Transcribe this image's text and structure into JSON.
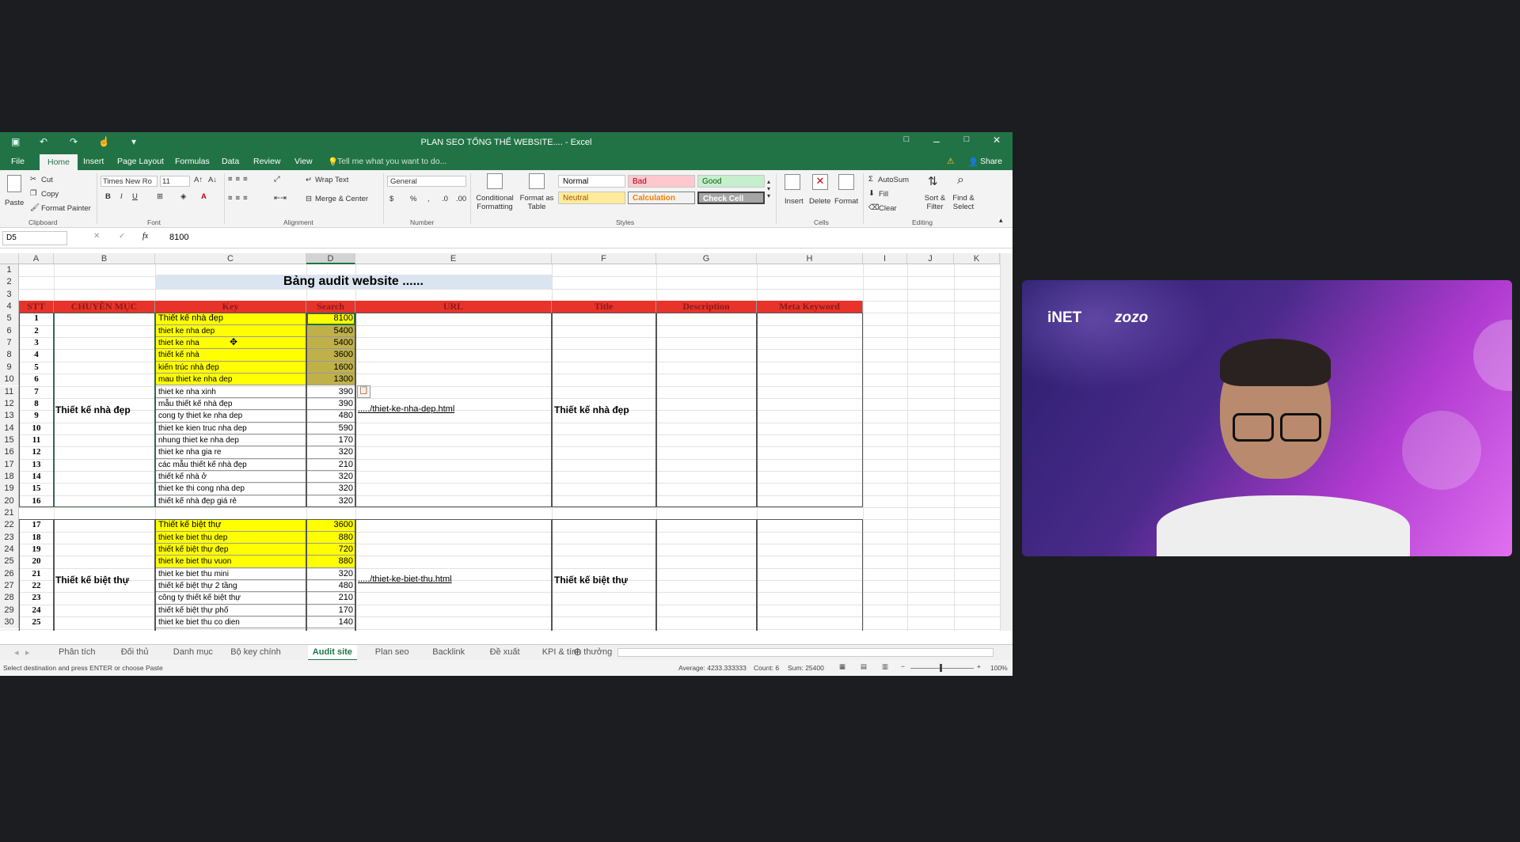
{
  "titlebar": {
    "title": "PLAN SEO TỔNG THỂ WEBSITE.... - Excel",
    "restore_icon": "□",
    "min": "–",
    "max": "□",
    "close": "✕"
  },
  "ribbon_tabs": {
    "file": "File",
    "home": "Home",
    "insert": "Insert",
    "page_layout": "Page Layout",
    "formulas": "Formulas",
    "data": "Data",
    "review": "Review",
    "view": "View",
    "tell": "Tell me what you want to do...",
    "share": "Share"
  },
  "ribbon": {
    "paste": "Paste",
    "cut": "Cut",
    "copy": "Copy",
    "format_painter": "Format Painter",
    "clipboard": "Clipboard",
    "font_name": "Times New Ro",
    "font_size": "11",
    "font": "Font",
    "wrap": "Wrap Text",
    "merge": "Merge & Center",
    "alignment": "Alignment",
    "number_format": "General",
    "number": "Number",
    "cond": "Conditional Formatting",
    "format_table": "Format as Table",
    "normal": "Normal",
    "bad": "Bad",
    "good": "Good",
    "neutral": "Neutral",
    "calculation": "Calculation",
    "check": "Check Cell",
    "styles": "Styles",
    "insert": "Insert",
    "delete": "Delete",
    "format": "Format",
    "cells": "Cells",
    "autosum": "AutoSum",
    "fill": "Fill",
    "clear": "Clear",
    "sort": "Sort & Filter",
    "find": "Find & Select",
    "editing": "Editing"
  },
  "formula_bar": {
    "cell_ref": "D5",
    "value": "8100",
    "fx": "fx"
  },
  "columns": [
    "A",
    "B",
    "C",
    "D",
    "E",
    "F",
    "G",
    "H",
    "I",
    "J",
    "K"
  ],
  "sheet": {
    "title": "Bảng audit website ......",
    "headers": {
      "stt": "STT",
      "chuyen_muc": "CHUYÊN MỤC",
      "key": "Key",
      "search": "Search",
      "url": "URL",
      "title": "Title",
      "description": "Description",
      "meta": "Meta Keyword"
    },
    "group1": {
      "name": "Thiết kế nhà đẹp",
      "url": "...../thiet-ke-nha-dep.html",
      "title": "Thiết kế nhà đẹp"
    },
    "group2": {
      "name": "Thiết kế biệt thự",
      "url": "...../thiet-ke-biet-thu.html",
      "title": "Thiết kế biệt thự"
    },
    "rows": [
      {
        "row": "5",
        "stt": "1",
        "key": "Thiết kế nhà đẹp",
        "search": "8100",
        "hl": "yel"
      },
      {
        "row": "6",
        "stt": "2",
        "key": "thiet ke nha dep",
        "search": "5400",
        "hl": "yel"
      },
      {
        "row": "7",
        "stt": "3",
        "key": "thiet ke nha",
        "search": "5400",
        "hl": "yel"
      },
      {
        "row": "8",
        "stt": "4",
        "key": "thiết kế nhà",
        "search": "3600",
        "hl": "yel"
      },
      {
        "row": "9",
        "stt": "5",
        "key": "kiến trúc nhà đẹp",
        "search": "1600",
        "hl": "yel"
      },
      {
        "row": "10",
        "stt": "6",
        "key": "mau thiet ke nha dep",
        "search": "1300",
        "hl": "yel"
      },
      {
        "row": "11",
        "stt": "7",
        "key": "thiet ke nha xinh",
        "search": "390",
        "hl": ""
      },
      {
        "row": "12",
        "stt": "8",
        "key": "mẫu thiết kế nhà đẹp",
        "search": "390",
        "hl": ""
      },
      {
        "row": "13",
        "stt": "9",
        "key": "cong ty thiet ke nha dep",
        "search": "480",
        "hl": ""
      },
      {
        "row": "14",
        "stt": "10",
        "key": "thiet ke kien truc nha dep",
        "search": "590",
        "hl": ""
      },
      {
        "row": "15",
        "stt": "11",
        "key": "nhung thiet ke nha dep",
        "search": "170",
        "hl": ""
      },
      {
        "row": "16",
        "stt": "12",
        "key": "thiet ke nha gia re",
        "search": "320",
        "hl": ""
      },
      {
        "row": "17",
        "stt": "13",
        "key": "các mẫu thiết kế nhà đẹp",
        "search": "210",
        "hl": ""
      },
      {
        "row": "18",
        "stt": "14",
        "key": "thiết kế nhà ở",
        "search": "320",
        "hl": ""
      },
      {
        "row": "19",
        "stt": "15",
        "key": "thiet ke thi cong nha dep",
        "search": "320",
        "hl": ""
      },
      {
        "row": "20",
        "stt": "16",
        "key": "thiết kế nhà đẹp giá rẻ",
        "search": "320",
        "hl": ""
      },
      {
        "row": "22",
        "stt": "17",
        "key": "Thiết kế biệt thự",
        "search": "3600",
        "hl": "yel"
      },
      {
        "row": "23",
        "stt": "18",
        "key": "thiet ke biet thu dep",
        "search": "880",
        "hl": "yel"
      },
      {
        "row": "24",
        "stt": "19",
        "key": "thiết kế biệt thự đẹp",
        "search": "720",
        "hl": "yel"
      },
      {
        "row": "25",
        "stt": "20",
        "key": "thiet ke biet thu vuon",
        "search": "880",
        "hl": "yel"
      },
      {
        "row": "26",
        "stt": "21",
        "key": "thiet ke biet thu mini",
        "search": "320",
        "hl": ""
      },
      {
        "row": "27",
        "stt": "22",
        "key": "thiết kế biệt thự 2 tầng",
        "search": "480",
        "hl": ""
      },
      {
        "row": "28",
        "stt": "23",
        "key": "công ty thiết kế biệt thự",
        "search": "210",
        "hl": ""
      },
      {
        "row": "29",
        "stt": "24",
        "key": "thiết kế biệt thự phố",
        "search": "170",
        "hl": ""
      },
      {
        "row": "30",
        "stt": "25",
        "key": "thiet ke biet thu co dien",
        "search": "140",
        "hl": ""
      }
    ]
  },
  "sheet_tabs": [
    "Phân tích",
    "Đối thủ",
    "Danh mục",
    "Bộ key chính",
    "Audit site",
    "Plan seo",
    "Backlink",
    "Đề xuất",
    "KPI & tính thưởng"
  ],
  "active_tab": "Audit site",
  "status": {
    "message": "Select destination and press ENTER or choose Paste",
    "average": "Average: 4233.333333",
    "count": "Count: 6",
    "sum": "Sum: 25400",
    "zoom": "100%"
  },
  "video": {
    "brand1": "iNET",
    "brand2": "zozo"
  },
  "colors": {
    "excel_green": "#217346",
    "header_red": "#e8332a",
    "highlight_yellow": "#ffff00",
    "olive": "#bfb04a"
  }
}
